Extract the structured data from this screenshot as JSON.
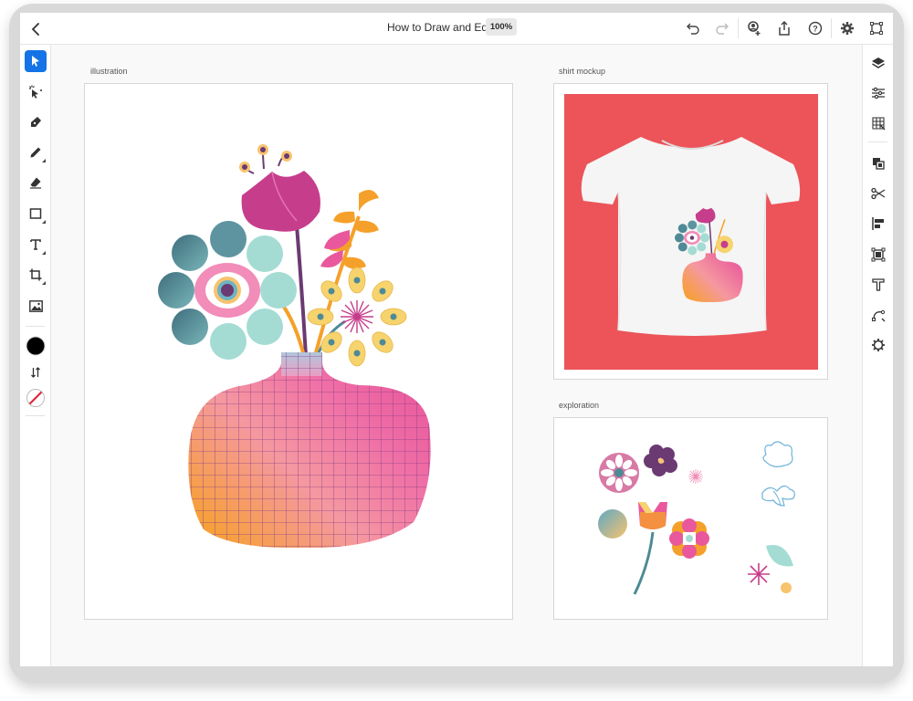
{
  "header": {
    "title": "How to Draw and Edit",
    "zoom": "100%"
  },
  "toolbar_left": {
    "tools": [
      "select-tool",
      "direct-select-tool",
      "pen-tool",
      "pencil-tool",
      "eraser-tool",
      "rectangle-tool",
      "type-tool",
      "crop-tool",
      "image-tool"
    ],
    "fill_color": "#000000",
    "stroke": "none"
  },
  "toolbar_right": {
    "tools": [
      "layers",
      "properties",
      "libraries",
      "arrange",
      "scissors",
      "align",
      "repeat-grid",
      "type-options",
      "path-tools",
      "plugins"
    ]
  },
  "artboards": {
    "illustration": {
      "label": "illustration"
    },
    "shirt": {
      "label": "shirt mockup",
      "background": "#ec5459"
    },
    "exploration": {
      "label": "exploration"
    }
  },
  "colors": {
    "accent": "#1473e6",
    "pink": "#c63d8b",
    "teal": "#4e8a95",
    "mint": "#a4dcd4",
    "orange": "#f5a02a",
    "yellow": "#f7d36e"
  }
}
